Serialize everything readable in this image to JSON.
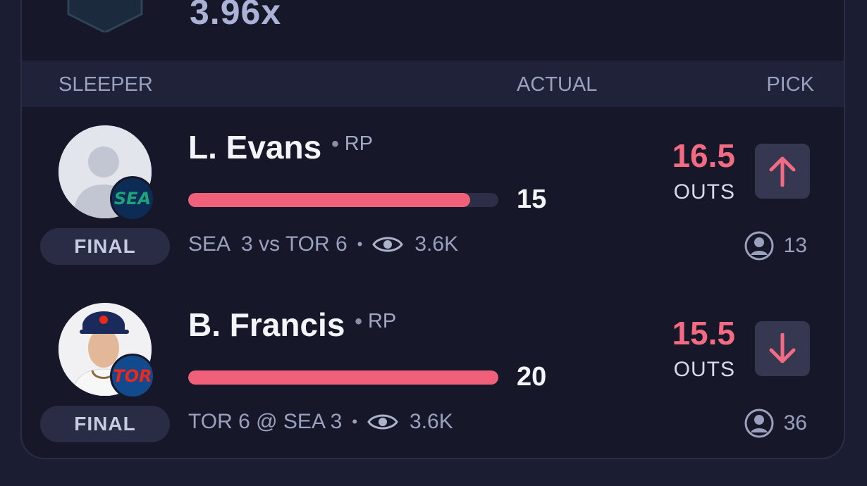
{
  "header": {
    "multiplier": "3.96x"
  },
  "columns": {
    "player": "SLEEPER",
    "actual": "ACTUAL",
    "pick": "PICK"
  },
  "rows": [
    {
      "name": "L. Evans",
      "position": "RP",
      "team": "SEA",
      "team_color": "#0c2c56",
      "team_text_color": "#1fa37b",
      "status": "FINAL",
      "actual": "15",
      "progress": 0.91,
      "line": "16.5",
      "unit": "OUTS",
      "direction": "up",
      "matchup": "SEA  3 vs TOR 6",
      "views": "3.6K",
      "pickers": "13"
    },
    {
      "name": "B. Francis",
      "position": "RP",
      "team": "TOR",
      "team_color": "#134a8e",
      "team_text_color": "#e8291c",
      "status": "FINAL",
      "actual": "20",
      "progress": 1.0,
      "line": "15.5",
      "unit": "OUTS",
      "direction": "down",
      "matchup": "TOR 6 @ SEA 3",
      "views": "3.6K",
      "pickers": "36"
    }
  ]
}
